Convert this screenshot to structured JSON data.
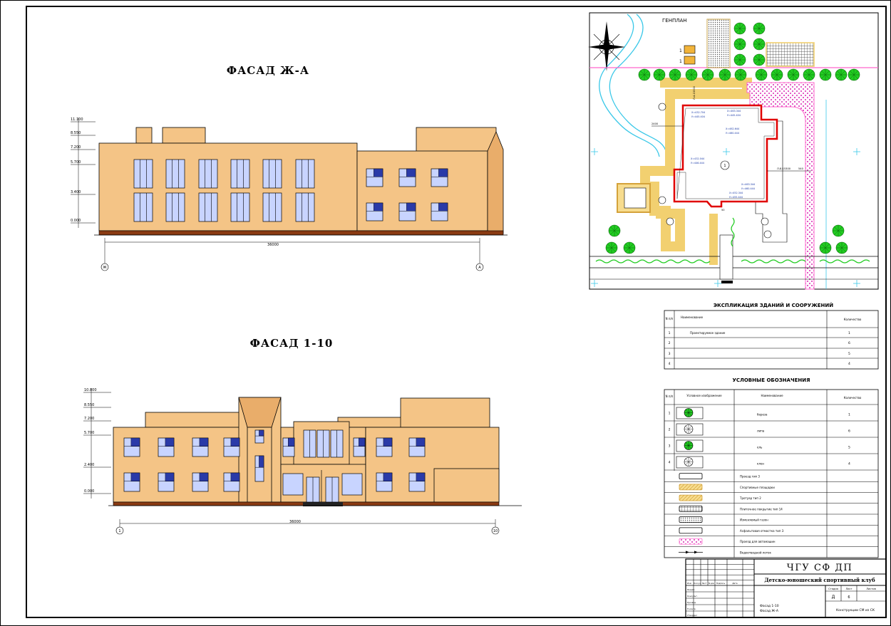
{
  "facade_top": {
    "title": "ФАСАД Ж-А",
    "levels": [
      "11.100",
      "8.550",
      "7.200",
      "5.700",
      "3.400",
      "0.000"
    ],
    "dimension": "36000",
    "axis_left": "Ж",
    "axis_right": "А"
  },
  "facade_bottom": {
    "title": "ФАСАД 1-10",
    "levels": [
      "10.800",
      "8.550",
      "7.200",
      "5.700",
      "2.400",
      "0.000"
    ],
    "dimension": "36000",
    "axis_left": "1",
    "axis_right": "10"
  },
  "genplan": {
    "title": "ГЕНПЛАН",
    "small_labels": [
      "1",
      "1"
    ],
    "coord_labels": [
      "Х=432.704",
      "У=445.404",
      "Х=463.344",
      "У=445.404",
      "Х=462.644",
      "У=460.444",
      "Х=432.044",
      "У=446.444",
      "Х=463.344",
      "У=460.444",
      "Х=452.344",
      "У=455.444"
    ],
    "dim_labels": [
      "Л-4-15300",
      "2400",
      "Л-8-15300",
      "540",
      "50"
    ],
    "building_label": "1"
  },
  "explication": {
    "title": "ЭКСПЛИКАЦИЯ ЗДАНИЙ И СООРУЖЕНИЙ",
    "headers": [
      "N п/п",
      "Наименование",
      "Количество"
    ],
    "rows": [
      {
        "n": "1",
        "name": "Проектируемое здание",
        "qty": "1"
      },
      {
        "n": "2",
        "name": "",
        "qty": "6"
      },
      {
        "n": "3",
        "name": "",
        "qty": "5"
      },
      {
        "n": "4",
        "name": "",
        "qty": "4"
      }
    ]
  },
  "legend": {
    "title": "УСЛОВНЫЕ ОБОЗНАЧЕНИЯ",
    "headers": [
      "N п/п",
      "Условное изображение",
      "Наименование",
      "Количество"
    ],
    "tree_rows": [
      {
        "n": "1",
        "name": "береза",
        "qty": "1",
        "color": "#22cc22"
      },
      {
        "n": "2",
        "name": "липа",
        "qty": "6",
        "color": "#ffffff"
      },
      {
        "n": "3",
        "name": "ель",
        "qty": "5",
        "color": "#22cc22"
      },
      {
        "n": "4",
        "name": "клен",
        "qty": "4",
        "color": "#ffffff"
      }
    ],
    "symbol_rows": [
      {
        "name": "Проезд тип 3"
      },
      {
        "name": "Спортивные площадки"
      },
      {
        "name": "Тротуар тип 2"
      },
      {
        "name": "Плиточное покрытие тип 14"
      },
      {
        "name": "Изменяемый газон"
      },
      {
        "name": "Асфальтовая отмостка тип 3"
      },
      {
        "name": "Проезд для автомашин"
      },
      {
        "name": "Водоотводной лоток"
      }
    ]
  },
  "title_block": {
    "org": "ЧГУ СФ ДП",
    "project": "Детско-юношеский спортивный клуб",
    "stage_headers": [
      "Стадия",
      "Лист",
      "Листов"
    ],
    "stage": "Д",
    "sheet": "6",
    "contents": [
      "Фасад 1-10",
      "Фасад Ж-А"
    ],
    "sheet_name": "Конструкции СМ из СК",
    "col_labels": [
      "Изм",
      "Кол.уч",
      "Лист",
      "N док",
      "Подпись",
      "Дата"
    ],
    "row_labels": [
      "Разраб.",
      "Консульт.",
      "Руковод.",
      "Н.контр.",
      "Утвердил"
    ]
  },
  "colors": {
    "wall": "#f4c486",
    "wall_dark": "#e9ad6a",
    "plinth": "#8a3a12",
    "window": "#c8d4ff",
    "tree_green": "#22cc22",
    "path_yellow": "#f2d070",
    "road_pink": "#ff66cc",
    "outline_red": "#e00000",
    "water_blue": "#3bc8e8"
  }
}
